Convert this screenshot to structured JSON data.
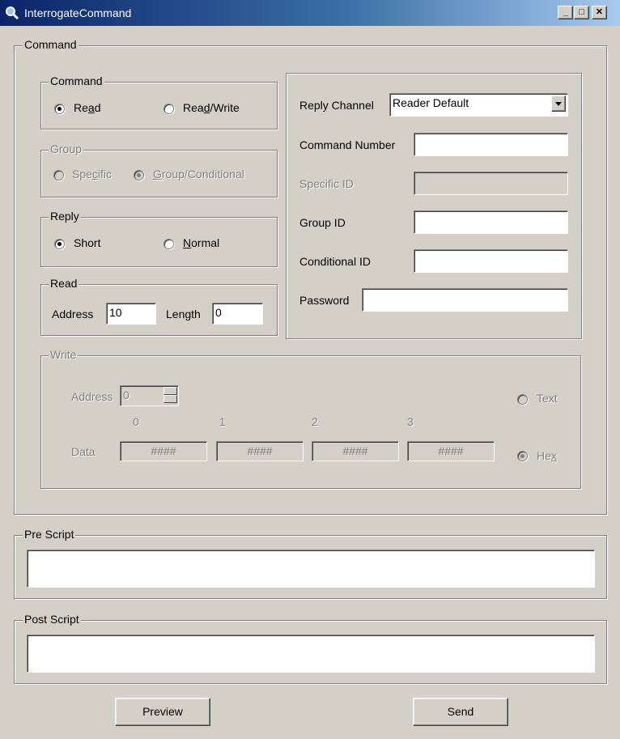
{
  "window": {
    "title": "InterrogateCommand"
  },
  "command_group": {
    "legend": "Command"
  },
  "command_type": {
    "legend": "Command",
    "read_label": "Read",
    "readwrite_label": "Read/Write",
    "selected": "Read"
  },
  "group": {
    "legend": "Group",
    "specific_label": "Specific",
    "groupcond_label": "Group/Conditional",
    "selected": "Group/Conditional"
  },
  "reply": {
    "legend": "Reply",
    "short_label": "Short",
    "normal_label": "Normal",
    "selected": "Short"
  },
  "read": {
    "legend": "Read",
    "address_label": "Address",
    "address_value": "10",
    "length_label": "Length",
    "length_value": "0"
  },
  "params": {
    "reply_channel_label": "Reply Channel",
    "reply_channel_value": "Reader Default",
    "command_number_label": "Command Number",
    "command_number_value": "",
    "specific_id_label": "Specific ID",
    "specific_id_value": "",
    "group_id_label": "Group ID",
    "group_id_value": "",
    "conditional_id_label": "Conditional ID",
    "conditional_id_value": "",
    "password_label": "Password",
    "password_value": ""
  },
  "write": {
    "legend": "Write",
    "address_label": "Address",
    "address_value": "0",
    "data_label": "Data",
    "indices": [
      "0",
      "1",
      "2",
      "3"
    ],
    "data_values": [
      "####",
      "####",
      "####",
      "####"
    ],
    "text_label": "Text",
    "hex_label": "Hex",
    "selected": "Hex"
  },
  "pre_script": {
    "legend": "Pre Script",
    "value": ""
  },
  "post_script": {
    "legend": "Post Script",
    "value": ""
  },
  "buttons": {
    "preview": "Preview",
    "send": "Send"
  }
}
